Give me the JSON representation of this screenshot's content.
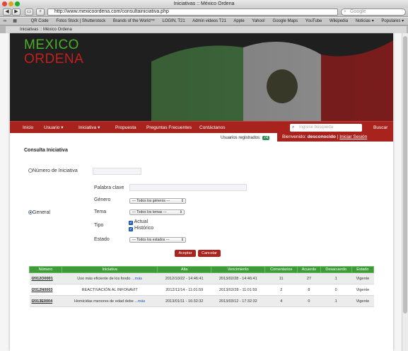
{
  "browser": {
    "window_title": "Iniciativas :: México Ordena",
    "url": "http://www.mexicoordena.com/consultainiciativa.php",
    "search_placeholder": "Google",
    "tab_title": "Iniciativas :: México Ordena",
    "bookmarks": [
      "QR Code",
      "Fotos Stock | Shutterstock",
      "Brands of the World™",
      "LOGIN, T21",
      "Admin videos T21",
      "Apple",
      "Yahoo!",
      "Google Maps",
      "YouTube",
      "Wikipedia",
      "Noticias ▾",
      "Populares ▾"
    ]
  },
  "logo": {
    "line1": "MEXICO",
    "line2": "ORDENA"
  },
  "nav": {
    "inicio": "Inicio",
    "usuario": "Usuario",
    "iniciativa": "Iniciativa",
    "propuesta": "Propuesta",
    "preguntas": "Preguntas Frecuentes",
    "contactanos": "Contáctanos",
    "search_placeholder": "Ingrese búsqueda",
    "buscar": "Buscar"
  },
  "status": {
    "registered_label": "Usuarios registrados:",
    "registered_count": "74",
    "welcome_label": "Bienvenido:",
    "user": "desconocido",
    "sep": "|",
    "login": "Iniciar Sesión"
  },
  "form": {
    "heading": "Consulta Iniciativa",
    "numero_label": "Número de Iniciativa",
    "general_label": "General",
    "palabra_label": "Palabra clave",
    "genero_label": "Género",
    "genero_value": "--- Todos los géneros ---",
    "tema_label": "Tema",
    "tema_value": "--- Todos los temas ---",
    "tipo_label": "Tipo",
    "tipo_actual": "Actual",
    "tipo_historico": "Histórico",
    "estado_label": "Estado",
    "estado_value": "--- Todos los estados ---",
    "aceptar": "Aceptar",
    "cancelar": "Cancelar"
  },
  "table": {
    "headers": [
      "Número",
      "Iniciativa",
      "Alta",
      "Vencimiento",
      "Comentarios",
      "Acuerdo",
      "Desacuerdo",
      "Estado"
    ],
    "rows": [
      {
        "numero": "I2012O0001",
        "iniciativa": "Uso más eficiente de los fondo",
        "mas": "...más",
        "alta": "2012/10/22 - 14:46:41",
        "venc": "2013/02/28 - 14:46:41",
        "com": "11",
        "acu": "27",
        "des": "1",
        "estado": "Vigente"
      },
      {
        "numero": "I2012N0003",
        "iniciativa": "REACTIVACIÓN AL INFONAVIT",
        "mas": "",
        "alta": "2012/11/14 - 11:01:59",
        "venc": "2013/02/28 - 11:01:59",
        "com": "2",
        "acu": "8",
        "des": "0",
        "estado": "Vigente"
      },
      {
        "numero": "I2013E0004",
        "iniciativa": "Homicidas menores de edad debe",
        "mas": "...más",
        "alta": "2013/01/11 - 16:32:32",
        "venc": "2013/03/12 - 17:32:32",
        "com": "4",
        "acu": "0",
        "des": "1",
        "estado": "Vigente"
      }
    ]
  }
}
